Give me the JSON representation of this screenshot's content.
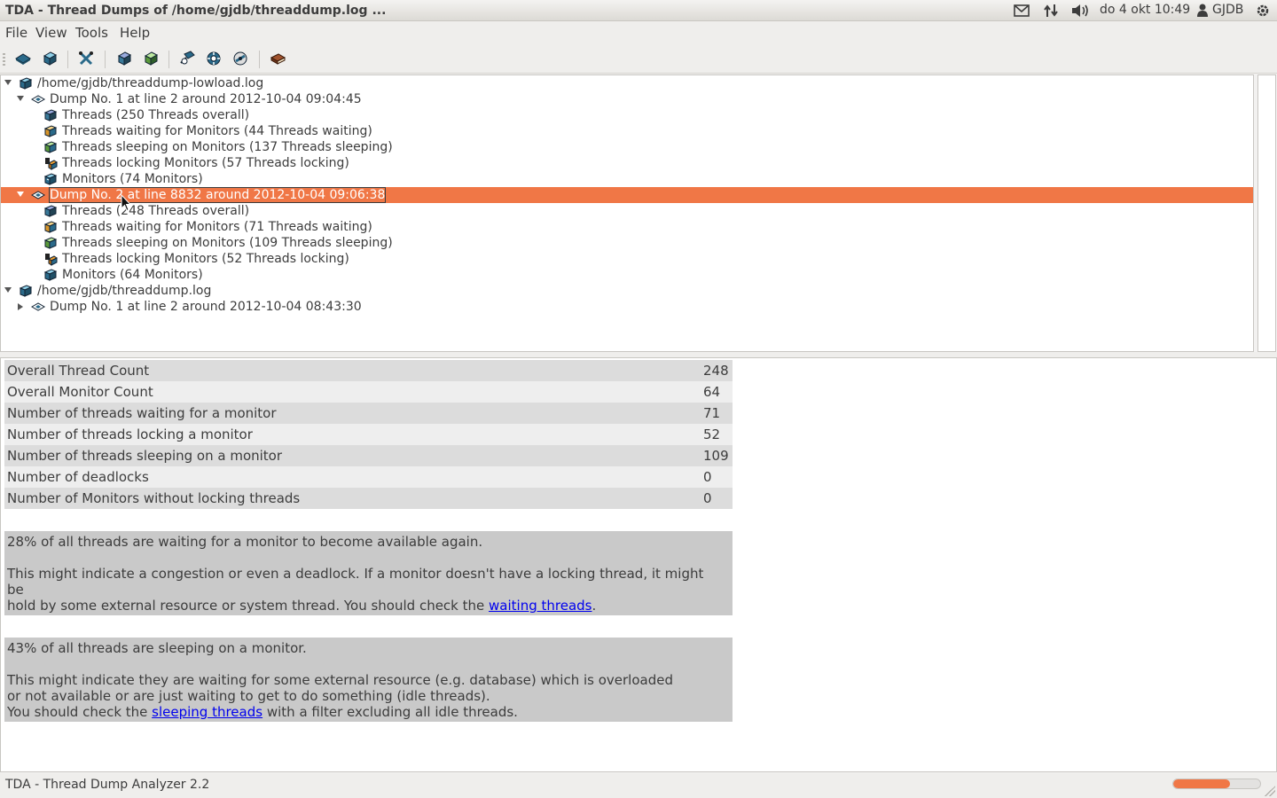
{
  "window": {
    "title": "TDA - Thread Dumps of /home/gjdb/threaddump.log ..."
  },
  "tray": {
    "date_time": "do  4 okt 10:49",
    "user": "GJDB"
  },
  "menu": {
    "file": "File",
    "view": "View",
    "tools": "Tools",
    "help": "Help"
  },
  "tree": {
    "file1": "/home/gjdb/threaddump-lowload.log",
    "dump1": "Dump No. 1 at line 2 around 2012-10-04 09:04:45",
    "dump1_threads": "Threads (250 Threads overall)",
    "dump1_waiting": "Threads waiting for Monitors (44 Threads waiting)",
    "dump1_sleeping": "Threads sleeping on Monitors (137 Threads sleeping)",
    "dump1_locking": "Threads locking Monitors (57 Threads locking)",
    "dump1_monitors": "Monitors (74 Monitors)",
    "dump2": "Dump No. 2 at line 8832 around 2012-10-04 09:06:38",
    "dump2_threads": "Threads (248 Threads overall)",
    "dump2_waiting": "Threads waiting for Monitors (71 Threads waiting)",
    "dump2_sleeping": "Threads sleeping on Monitors (109 Threads sleeping)",
    "dump2_locking": "Threads locking Monitors (52 Threads locking)",
    "dump2_monitors": "Monitors (64 Monitors)",
    "file2": "/home/gjdb/threaddump.log",
    "file2_dump1": "Dump No. 1 at line 2 around 2012-10-04 08:43:30"
  },
  "stats": [
    {
      "label": "Overall Thread Count",
      "value": "248"
    },
    {
      "label": "Overall Monitor Count",
      "value": "64"
    },
    {
      "label": "Number of threads waiting for a monitor",
      "value": "71"
    },
    {
      "label": "Number of threads locking a monitor",
      "value": "52"
    },
    {
      "label": "Number of threads sleeping on a monitor",
      "value": "109"
    },
    {
      "label": "Number of deadlocks",
      "value": "0"
    },
    {
      "label": "Number of Monitors without locking threads",
      "value": "0"
    }
  ],
  "notes": {
    "waiting_headline": "28% of all threads are waiting for a monitor to become available again.",
    "waiting_line1": "This might indicate a congestion or even a deadlock. If a monitor doesn't have a locking thread, it might",
    "waiting_line2": "be",
    "waiting_line3": "hold by some external resource or system thread. You should check the ",
    "waiting_link": "waiting threads",
    "waiting_end": ".",
    "sleeping_headline": "43% of all threads are sleeping on a monitor.",
    "sleeping_line1": "This might indicate they are waiting for some external resource (e.g. database) which is overloaded",
    "sleeping_line2": "or not available or are just waiting to get to do something (idle threads).",
    "sleeping_line3": "You should check the ",
    "sleeping_link": "sleeping threads",
    "sleeping_end": " with a filter excluding all idle threads."
  },
  "status": {
    "text": "TDA - Thread Dump Analyzer 2.2",
    "progress_fraction": 0.65
  },
  "colors": {
    "selection": "#f07746",
    "link": "#0000ee"
  }
}
